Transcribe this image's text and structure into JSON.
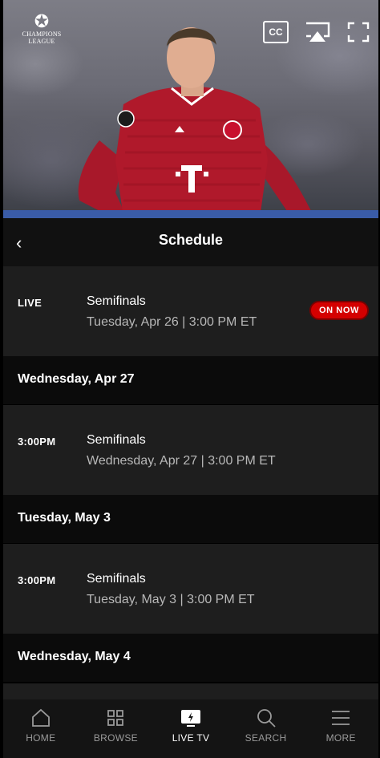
{
  "video": {
    "logo_text": [
      "CHAMPIONS",
      "LEAGUE"
    ],
    "cc_label": "CC"
  },
  "header": {
    "title": "Schedule"
  },
  "schedule": [
    {
      "time": "LIVE",
      "name": "Semifinals",
      "when": "Tuesday, Apr 26 | 3:00 PM ET",
      "badge": "ON NOW"
    },
    {
      "date_heading": "Wednesday, Apr 27"
    },
    {
      "time": "3:00PM",
      "name": "Semifinals",
      "when": "Wednesday, Apr 27 | 3:00 PM ET"
    },
    {
      "date_heading": "Tuesday, May 3"
    },
    {
      "time": "3:00PM",
      "name": "Semifinals",
      "when": "Tuesday, May 3 | 3:00 PM ET"
    },
    {
      "date_heading": "Wednesday, May 4"
    }
  ],
  "nav": {
    "items": [
      {
        "label": "HOME",
        "icon": "home-icon"
      },
      {
        "label": "BROWSE",
        "icon": "grid-icon"
      },
      {
        "label": "LIVE TV",
        "icon": "live-tv-icon",
        "active": true
      },
      {
        "label": "SEARCH",
        "icon": "search-icon"
      },
      {
        "label": "MORE",
        "icon": "menu-icon"
      }
    ]
  },
  "colors": {
    "on_now": "#d40000",
    "jersey": "#b0192b",
    "background": "#000000"
  }
}
